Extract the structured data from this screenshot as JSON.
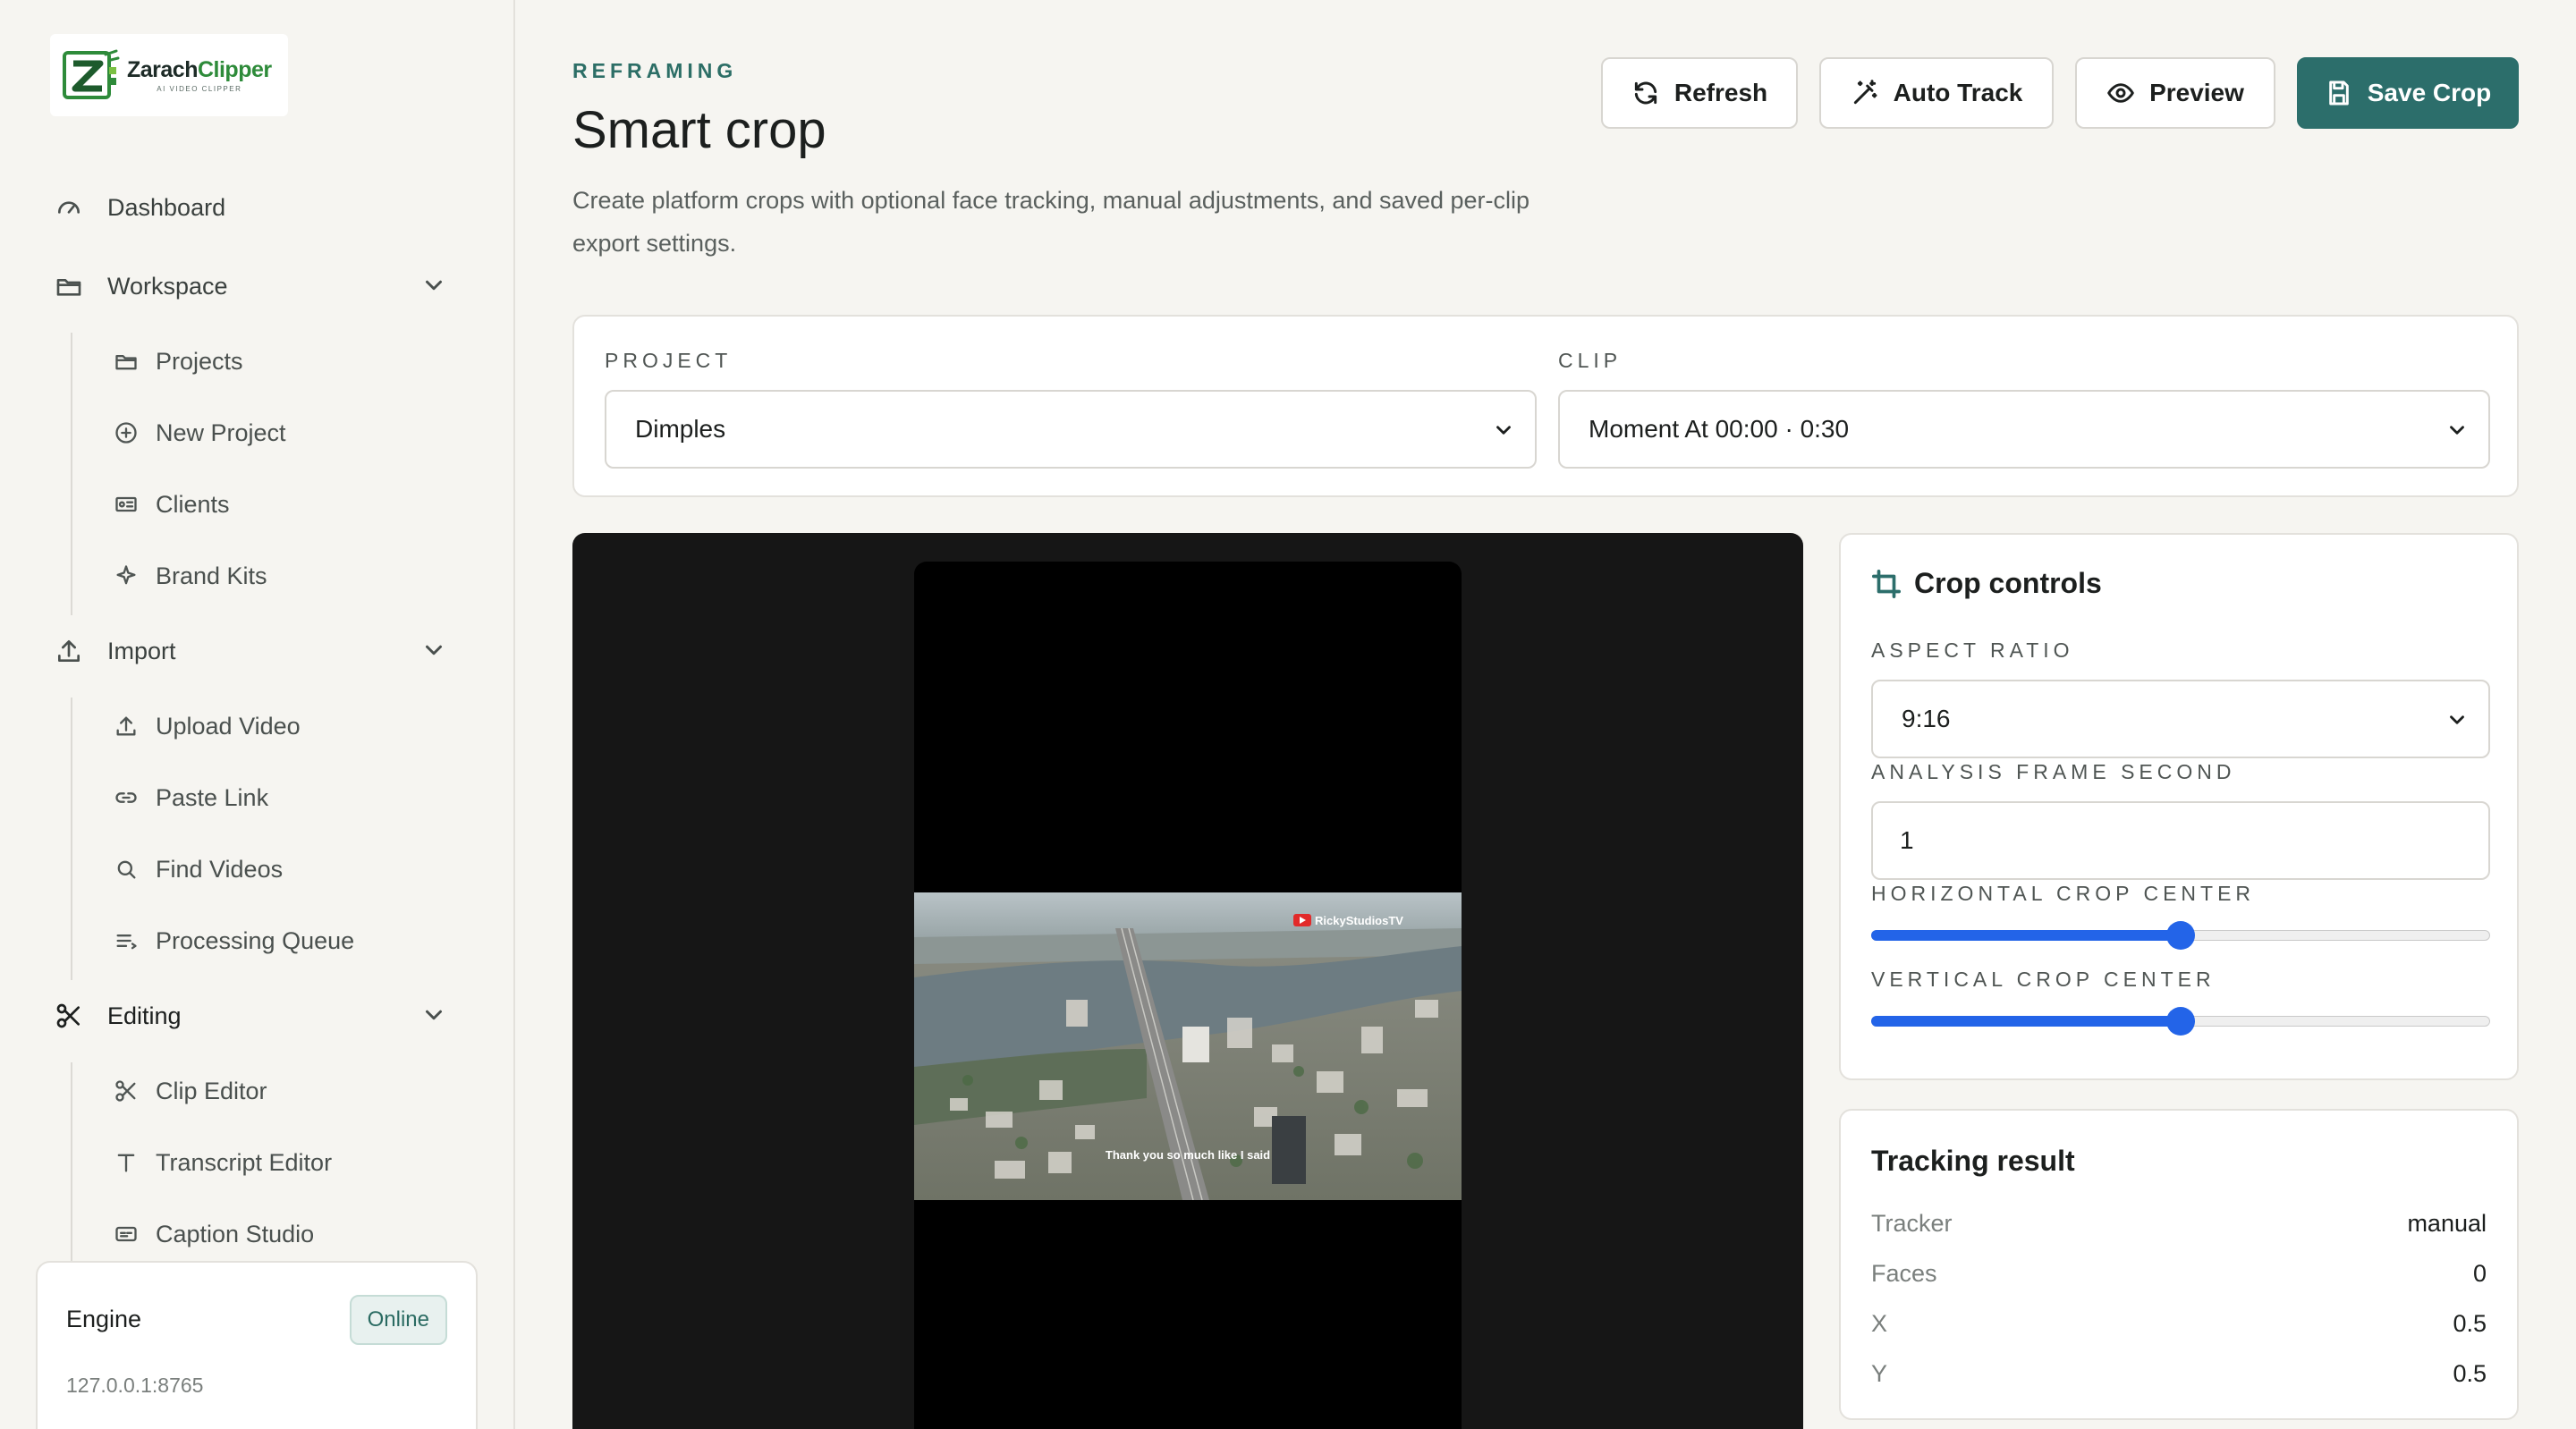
{
  "brand": {
    "name_prefix": "Zarach",
    "name_suffix": "Clipper",
    "tagline": "AI VIDEO CLIPPER"
  },
  "sidebar": {
    "dashboard": "Dashboard",
    "workspace": {
      "label": "Workspace",
      "items": [
        "Projects",
        "New Project",
        "Clients",
        "Brand Kits"
      ]
    },
    "import": {
      "label": "Import",
      "items": [
        "Upload Video",
        "Paste Link",
        "Find Videos",
        "Processing Queue"
      ]
    },
    "editing": {
      "label": "Editing",
      "items": [
        "Clip Editor",
        "Transcript Editor",
        "Caption Studio"
      ]
    }
  },
  "engine": {
    "title": "Engine",
    "status": "Online",
    "address": "127.0.0.1:8765"
  },
  "header": {
    "eyebrow": "REFRAMING",
    "title": "Smart crop",
    "description": "Create platform crops with optional face tracking, manual adjustments, and saved per-clip export settings."
  },
  "toolbar": {
    "refresh": "Refresh",
    "auto_track": "Auto Track",
    "preview": "Preview",
    "save_crop": "Save Crop"
  },
  "selectors": {
    "project_label": "PROJECT",
    "project_value": "Dimples",
    "clip_label": "CLIP",
    "clip_value": "Moment At 00:00 · 0:30"
  },
  "video": {
    "watermark": "RickyStudiosTV",
    "subtitle": "Thank you so much like I said"
  },
  "crop_controls": {
    "title": "Crop controls",
    "aspect_label": "ASPECT RATIO",
    "aspect_value": "9:16",
    "frame_label": "ANALYSIS FRAME SECOND",
    "frame_value": "1",
    "h_label": "HORIZONTAL CROP CENTER",
    "h_value": 0.5,
    "v_label": "VERTICAL CROP CENTER",
    "v_value": 0.5
  },
  "tracking": {
    "title": "Tracking result",
    "rows": [
      {
        "key": "Tracker",
        "value": "manual"
      },
      {
        "key": "Faces",
        "value": "0"
      },
      {
        "key": "X",
        "value": "0.5"
      },
      {
        "key": "Y",
        "value": "0.5"
      }
    ]
  },
  "colors": {
    "accent": "#2c6e6b",
    "slider": "#2364e8",
    "logo_green": "#2e8b3a"
  }
}
